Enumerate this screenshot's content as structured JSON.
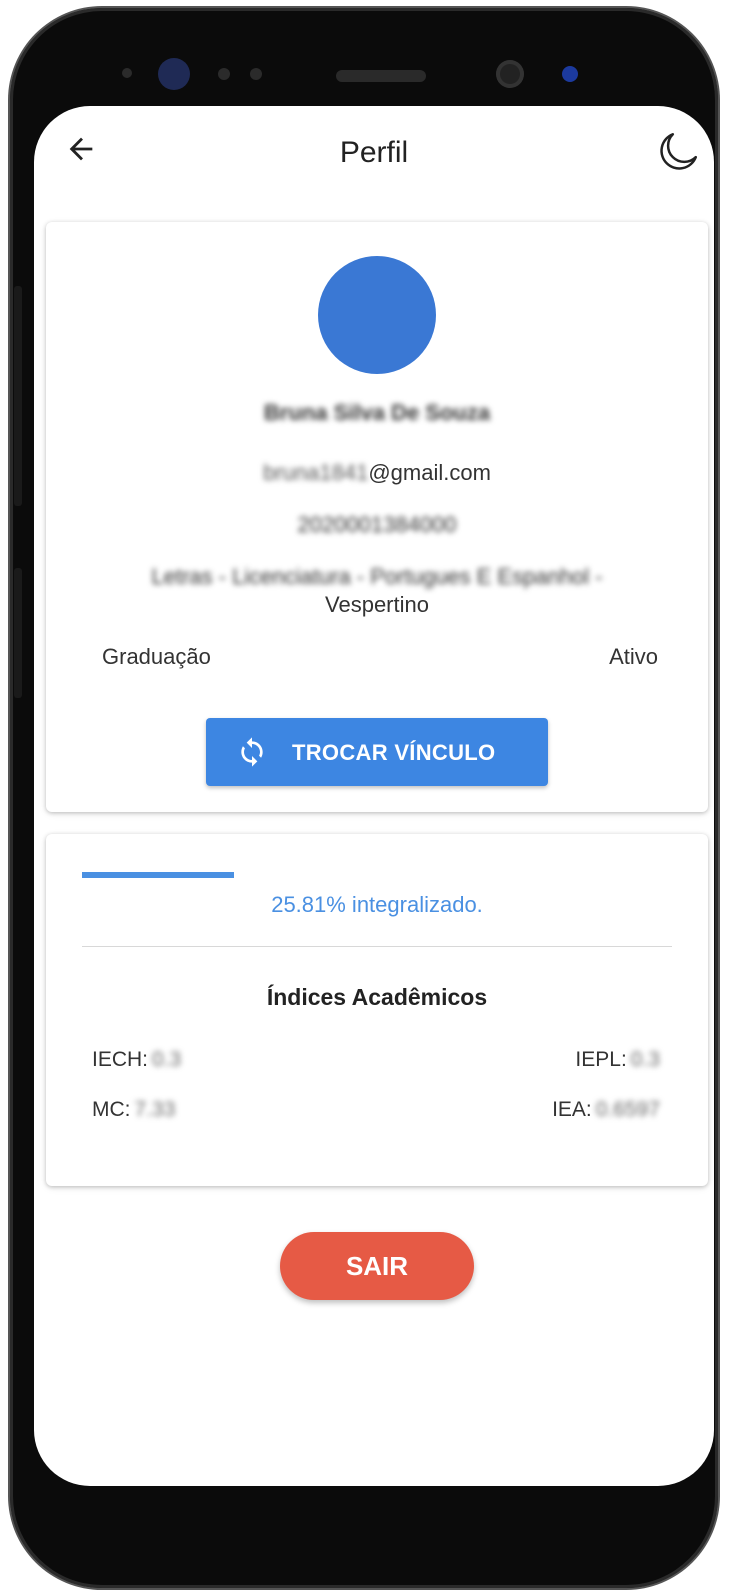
{
  "appbar": {
    "title": "Perfil"
  },
  "profile": {
    "name": "Bruna Silva De Souza",
    "email_user": "bruna1841",
    "email_domain": "@gmail.com",
    "registration": "2020001384000",
    "course_line1": "Letras - Licenciatura - Portugues E Espanhol -",
    "course_line2": "Vespertino",
    "level": "Graduação",
    "status": "Ativo",
    "swap_button": "TROCAR VÍNCULO",
    "avatar_color": "#3a78d4"
  },
  "progress": {
    "percent": 25.81,
    "text": "25.81% integralizado."
  },
  "indices": {
    "title": "Índices Acadêmicos",
    "iech_label": "IECH:",
    "iech_value": "0.3",
    "iepl_label": "IEPL:",
    "iepl_value": "0.3",
    "mc_label": "MC:",
    "mc_value": "7.33",
    "iea_label": "IEA:",
    "iea_value": "0.6597"
  },
  "exit_button": "SAIR",
  "colors": {
    "primary": "#3d86e2",
    "danger": "#e65a45",
    "progress": "#4a90e2"
  },
  "icons": {
    "back": "arrow-left-icon",
    "theme": "moon-icon",
    "swap": "sync-icon"
  }
}
